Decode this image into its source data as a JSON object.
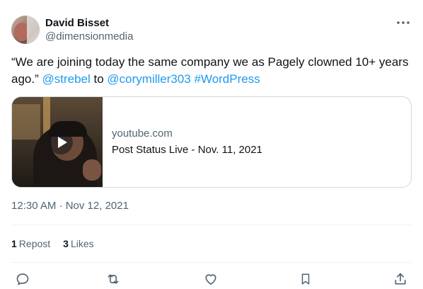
{
  "author": {
    "name": "David Bisset",
    "handle": "@dimensionmedia",
    "avatar_icon": "avatar-photo"
  },
  "more_icon": "more-dots-icon",
  "tweet": {
    "text_before": "“We are joining today the same company we as Pagely clowned 10+ years ago.” ",
    "mention_1": "@strebel",
    "text_middle": " to ",
    "mention_2": "@corymiller303",
    "text_space": " ",
    "hashtag": "#WordPress"
  },
  "card": {
    "domain": "youtube.com",
    "title": "Post Status Live - Nov. 11, 2021",
    "thumbnail_icon": "video-thumbnail",
    "play_icon": "play-icon"
  },
  "timestamp": "12:30 AM · Nov 12, 2021",
  "stats": {
    "reposts_count": "1",
    "reposts_label": "Repost",
    "likes_count": "3",
    "likes_label": "Likes"
  },
  "actions": {
    "reply_icon": "reply-icon",
    "repost_icon": "repost-icon",
    "like_icon": "heart-icon",
    "bookmark_icon": "bookmark-icon",
    "share_icon": "share-icon"
  },
  "colors": {
    "link": "#1d9bf0",
    "text": "#0f1419",
    "secondary": "#536471",
    "border": "#cfd9de"
  }
}
